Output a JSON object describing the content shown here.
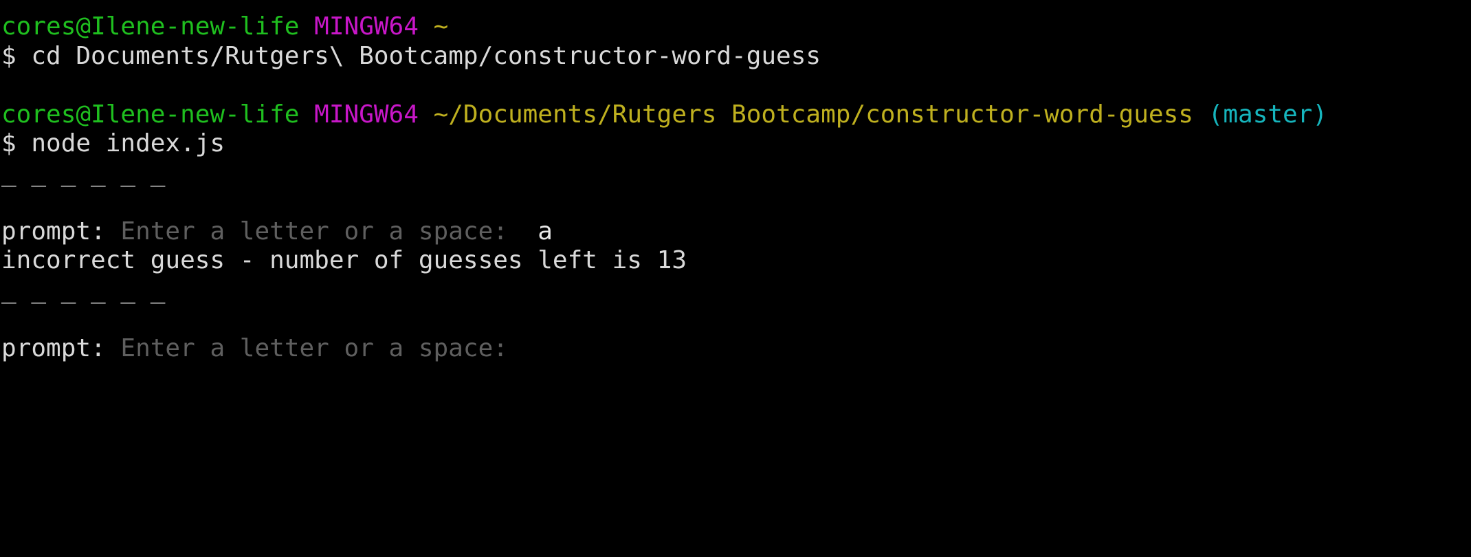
{
  "colors": {
    "background": "#000000",
    "foreground": "#d9d9d9",
    "user": "#1fbf1f",
    "host": "#c817c8",
    "path": "#bfb01f",
    "branch": "#16b5bd",
    "prompt_hint": "#5f5f5f"
  },
  "block1": {
    "user_host": "cores@Ilene-new-life",
    "shell": "MINGW64",
    "path": "~",
    "command": "$ cd Documents/Rutgers\\ Bootcamp/constructor-word-guess"
  },
  "block2": {
    "user_host": "cores@Ilene-new-life",
    "shell": "MINGW64",
    "path": "~/Documents/Rutgers Bootcamp/constructor-word-guess",
    "branch": "(master)",
    "command": "$ node index.js"
  },
  "game": {
    "blanks_1": "_ _ _ _ _ _",
    "prompt_label_1": "prompt:",
    "prompt_hint_1": "Enter a letter or a space:",
    "answer_1": "a",
    "result_1": "incorrect guess - number of guesses left is 13",
    "blanks_2": "_ _ _ _ _ _",
    "prompt_label_2": "prompt:",
    "prompt_hint_2": "Enter a letter or a space:"
  }
}
